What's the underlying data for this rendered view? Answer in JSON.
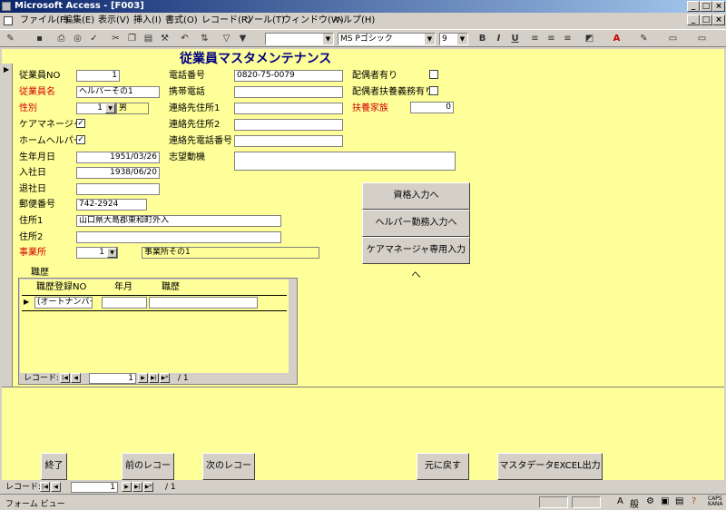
{
  "window": {
    "title": "Microsoft Access - [F003]"
  },
  "menu": [
    "ファイル(F)",
    "編集(E)",
    "表示(V)",
    "挿入(I)",
    "書式(O)",
    "レコード(R)",
    "ツール(T)",
    "ウィンドウ(W)",
    "ヘルプ(H)"
  ],
  "toolbar": {
    "font_name": "MS Pゴシック",
    "font_size": "9"
  },
  "form": {
    "title": "従業員マスタメンテナンス",
    "fields": {
      "emp_no": {
        "label": "従業員NO",
        "value": "1"
      },
      "emp_name": {
        "label": "従業員名",
        "value": "ヘルパーその1"
      },
      "gender": {
        "label": "性別",
        "value": "1",
        "display": "男"
      },
      "care_manager": {
        "label": "ケアマネージャ",
        "checked": "✓"
      },
      "home_helper": {
        "label": "ホームヘルパー",
        "checked": "✓"
      },
      "birth_date": {
        "label": "生年月日",
        "value": "1951/03/26"
      },
      "join_date": {
        "label": "入社日",
        "value": "1938/06/20"
      },
      "leave_date": {
        "label": "退社日",
        "value": ""
      },
      "postal": {
        "label": "郵便番号",
        "value": "742-2924"
      },
      "address1": {
        "label": "住所1",
        "value": "山口県大島郡東和町外入"
      },
      "address2": {
        "label": "住所2",
        "value": ""
      },
      "office": {
        "label": "事業所",
        "value": "1",
        "display": "事業所その1"
      },
      "phone": {
        "label": "電話番号",
        "value": "0820-75-0079"
      },
      "mobile": {
        "label": "携帯電話",
        "value": ""
      },
      "contact_addr1": {
        "label": "連絡先住所1",
        "value": ""
      },
      "contact_addr2": {
        "label": "連絡先住所2",
        "value": ""
      },
      "contact_phone": {
        "label": "連絡先電話番号",
        "value": ""
      },
      "motivation": {
        "label": "志望動機",
        "value": ""
      },
      "spouse": {
        "label": "配偶者有り"
      },
      "spouse_support": {
        "label": "配偶者扶養義務有り"
      },
      "dependents": {
        "label": "扶養家族",
        "value": "0"
      }
    },
    "buttons": {
      "qualification": "資格入力へ",
      "helper_work": "ヘルパー勤務入力へ",
      "care_manager": "ケアマネージャ専用入力へ"
    },
    "history": {
      "title": "職歴",
      "columns": [
        "職歴登録NO",
        "年月",
        "職歴"
      ],
      "row": [
        "(オートナンバー)",
        "",
        ""
      ],
      "nav_label": "レコード:",
      "nav_current": "1",
      "nav_total": "/ 1"
    }
  },
  "footer_buttons": {
    "end": "終了",
    "prev": "前のレコード",
    "next": "次のレコード",
    "undo": "元に戻す",
    "excel": "マスタデータEXCEL出力"
  },
  "record_nav": {
    "label": "レコード:",
    "current": "1",
    "total": "/ 1"
  },
  "status": {
    "text": "フォーム ビュー"
  }
}
